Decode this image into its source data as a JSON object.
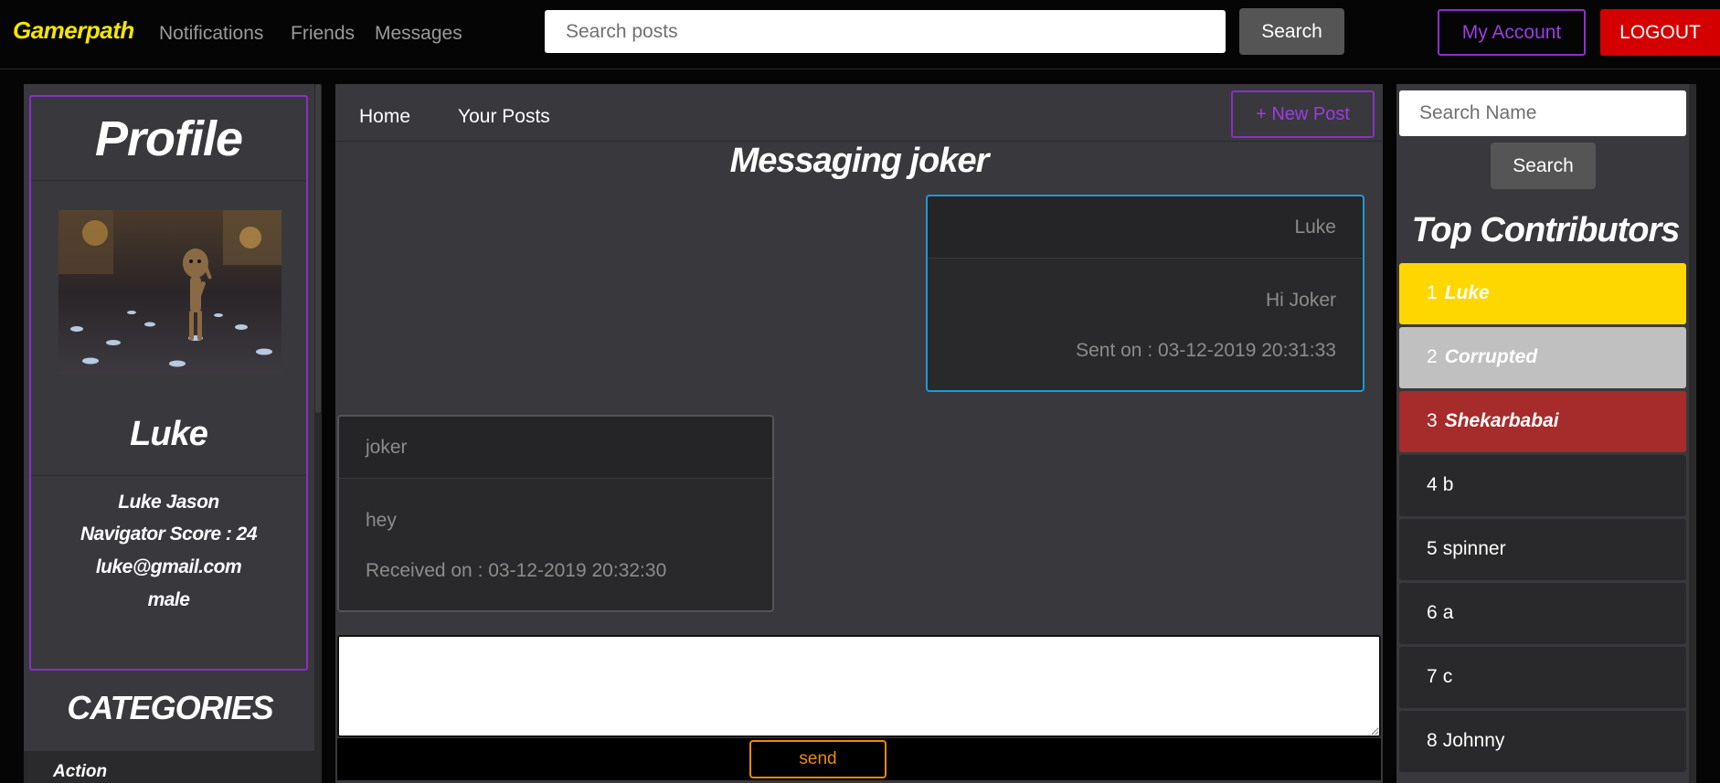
{
  "navbar": {
    "brand": "Gamerpath",
    "links": [
      "Notifications",
      "Friends",
      "Messages"
    ],
    "search_placeholder": "Search posts",
    "search_label": "Search",
    "account_label": "My Account",
    "logout_label": "LOGOUT"
  },
  "profile": {
    "title": "Profile",
    "username": "Luke",
    "full_name": "Luke Jason",
    "score": "Navigator Score : 24",
    "email": "luke@gmail.com",
    "gender": "male"
  },
  "categories": {
    "title": "CATEGORIES",
    "items": [
      "Action"
    ]
  },
  "main": {
    "tabs": [
      "Home",
      "Your Posts"
    ],
    "new_post_label": "+ New Post",
    "heading": "Messaging joker",
    "messages": [
      {
        "sender": "Luke",
        "text": "Hi Joker",
        "time": "Sent on : 03-12-2019 20:31:33"
      },
      {
        "sender": "joker",
        "text": "hey",
        "time": "Received on : 03-12-2019 20:32:30"
      }
    ],
    "send_label": "send"
  },
  "right": {
    "search_placeholder": "Search Name",
    "search_label": "Search",
    "title": "Top Contributors",
    "contributors": [
      {
        "rank": "1",
        "name": "Luke",
        "color": "#ffd700"
      },
      {
        "rank": "2",
        "name": "Corrupted",
        "color": "#c0c0c0"
      },
      {
        "rank": "3",
        "name": "Shekarbabai",
        "color": "#a62b2b"
      },
      {
        "rank": "4",
        "name": "b",
        "color": "#29292b"
      },
      {
        "rank": "5",
        "name": "spinner",
        "color": "#29292b"
      },
      {
        "rank": "6",
        "name": "a",
        "color": "#29292b"
      },
      {
        "rank": "7",
        "name": "c",
        "color": "#29292b"
      },
      {
        "rank": "8",
        "name": "Johnny",
        "color": "#29292b"
      }
    ]
  },
  "colors": {
    "brand": "#f4e600",
    "accent_purple": "#8a2fc9",
    "logout_red": "#d40000",
    "sent_border": "#1f97d8",
    "send_orange": "#f08a00"
  }
}
